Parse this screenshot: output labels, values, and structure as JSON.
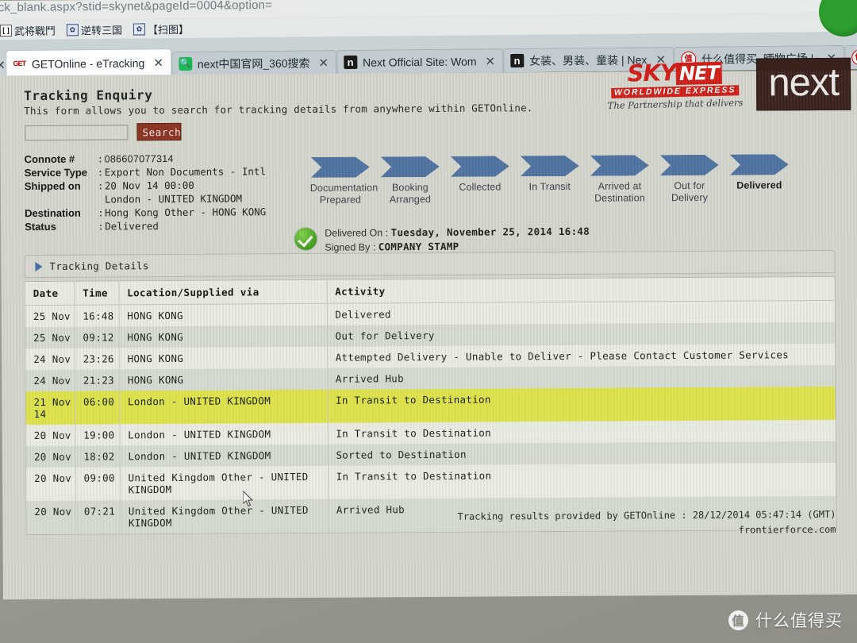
{
  "browser": {
    "url_strip": "ck_blank.aspx?stid=skynet&pageId=0004&option=",
    "bookmarks": [
      {
        "icon": "brackets-icon",
        "label": "武将戰鬥"
      },
      {
        "icon": "baidu-paw-icon",
        "label": "逆转三国"
      },
      {
        "icon": "baidu-paw-icon",
        "label": "【扫图】"
      }
    ],
    "tabs": [
      {
        "favicon": "getonline-icon",
        "label": "GETOnline - eTracking",
        "active": true,
        "close": "✕"
      },
      {
        "favicon": "search360-icon",
        "label": "next中国官网_360搜索",
        "active": false,
        "close": "✕"
      },
      {
        "favicon": "next-icon",
        "label": "Next Official Site: Wom",
        "active": false,
        "close": "✕"
      },
      {
        "favicon": "next-icon",
        "label": "女装、男装、童装 | Next",
        "active": false,
        "close": "✕"
      },
      {
        "favicon": "smzdm-icon",
        "label": "什么值得买_晒物广场 | 值",
        "active": false,
        "close": "✕"
      }
    ],
    "left_close": "✕"
  },
  "logos": {
    "skynet_main": "SKY",
    "skynet_net": "NET",
    "skynet_sub": "WORLDWIDE EXPRESS",
    "skynet_tagline": "The Partnership that delivers",
    "next": "next"
  },
  "header": {
    "title": "Tracking Enquiry",
    "subtitle": "This form allows you to search for tracking details from anywhere within GETOnline."
  },
  "search": {
    "value": "",
    "placeholder": "",
    "button_label": "Search"
  },
  "consignment": {
    "rows": [
      {
        "key": "Connote #",
        "colon": ":",
        "value": "086607077314",
        "mono": false
      },
      {
        "key": "Service Type",
        "colon": ":",
        "value": "Export Non Documents - Intl",
        "mono": true
      },
      {
        "key": "Shipped on",
        "colon": ":",
        "value": "20 Nov 14 00:00",
        "mono": true
      },
      {
        "key": "",
        "colon": "",
        "value": "London - UNITED KINGDOM",
        "mono": true
      },
      {
        "key": "Destination",
        "colon": ":",
        "value": "Hong Kong Other - HONG KONG",
        "mono": true
      },
      {
        "key": "Status",
        "colon": ":",
        "value": "Delivered",
        "mono": true
      }
    ]
  },
  "progress": {
    "steps": [
      {
        "line1": "Documentation",
        "line2": "Prepared",
        "done": false
      },
      {
        "line1": "Booking",
        "line2": "Arranged",
        "done": false
      },
      {
        "line1": "Collected",
        "line2": "",
        "done": false
      },
      {
        "line1": "In Transit",
        "line2": "",
        "done": false
      },
      {
        "line1": "Arrived at",
        "line2": "Destination",
        "done": false
      },
      {
        "line1": "Out for",
        "line2": "Delivery",
        "done": false
      },
      {
        "line1": "Delivered",
        "line2": "",
        "done": true
      }
    ],
    "chevron_color": "#4e72a0"
  },
  "delivery": {
    "icon": "green-check-icon",
    "delivered_on_label": "Delivered On",
    "delivered_on_value": "Tuesday, November 25, 2014 16:48",
    "signed_by_label": "Signed By",
    "signed_by_value": "COMPANY STAMP"
  },
  "details": {
    "panel_title": "Tracking Details",
    "columns": [
      "Date",
      "Time",
      "Location/Supplied via",
      "Activity"
    ],
    "rows": [
      {
        "date": "25 Nov",
        "date2": "",
        "time": "16:48",
        "location": "HONG KONG",
        "activity": "Delivered",
        "highlight": false
      },
      {
        "date": "25 Nov",
        "date2": "",
        "time": "09:12",
        "location": "HONG KONG",
        "activity": "Out for Delivery",
        "highlight": false
      },
      {
        "date": "24 Nov",
        "date2": "",
        "time": "23:26",
        "location": "HONG KONG",
        "activity": "Attempted Delivery - Unable to Deliver - Please Contact Customer Services",
        "highlight": false
      },
      {
        "date": "24 Nov",
        "date2": "",
        "time": "21:23",
        "location": "HONG KONG",
        "activity": "Arrived Hub",
        "highlight": false
      },
      {
        "date": "21 Nov",
        "date2": "14",
        "time": "06:00",
        "location": "London - UNITED KINGDOM",
        "activity": "In Transit to Destination",
        "highlight": true
      },
      {
        "date": "20 Nov",
        "date2": "",
        "time": "19:00",
        "location": "London - UNITED KINGDOM",
        "activity": "In Transit to Destination",
        "highlight": false
      },
      {
        "date": "20 Nov",
        "date2": "",
        "time": "18:02",
        "location": "London - UNITED KINGDOM",
        "activity": "Sorted to Destination",
        "highlight": false
      },
      {
        "date": "20 Nov",
        "date2": "",
        "time": "09:00",
        "location": "United Kingdom Other - UNITED KINGDOM",
        "activity": "In Transit to Destination",
        "highlight": false
      },
      {
        "date": "20 Nov",
        "date2": "",
        "time": "07:21",
        "location": "United Kingdom Other - UNITED KINGDOM",
        "activity": "Arrived Hub",
        "highlight": false
      }
    ],
    "highlight_color": "#dee34b"
  },
  "footer": {
    "line1": "Tracking results provided by GETOnline : 28/12/2014 05:47:14 (GMT)",
    "line2": "frontierforce.com"
  },
  "watermark": {
    "icon_char": "值",
    "text": "什么值得买"
  }
}
